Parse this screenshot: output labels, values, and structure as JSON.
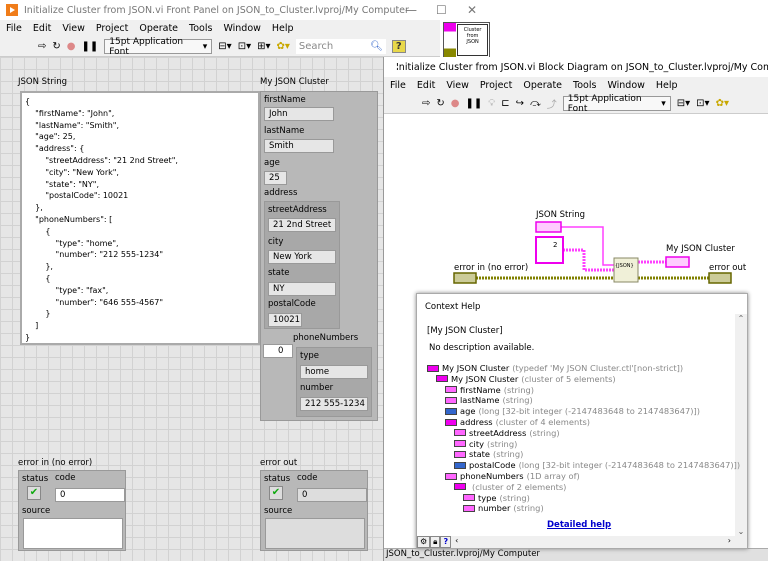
{
  "front_panel": {
    "title": "Initialize Cluster from JSON.vi Front Panel on JSON_to_Cluster.lvproj/My Computer",
    "menu": [
      "File",
      "Edit",
      "View",
      "Project",
      "Operate",
      "Tools",
      "Window",
      "Help"
    ],
    "font": "15pt Application Font",
    "search_placeholder": "Search",
    "icon_text": "Cluster from JSON",
    "json_string": {
      "label": "JSON String",
      "value": "{\n    \"firstName\": \"John\",\n    \"lastName\": \"Smith\",\n    \"age\": 25,\n    \"address\": {\n        \"streetAddress\": \"21 2nd Street\",\n        \"city\": \"New York\",\n        \"state\": \"NY\",\n        \"postalCode\": 10021\n    },\n    \"phoneNumbers\": [\n        {\n            \"type\": \"home\",\n            \"number\": \"212 555-1234\"\n        },\n        {\n            \"type\": \"fax\",\n            \"number\": \"646 555-4567\"\n        }\n    ]\n}"
    },
    "cluster": {
      "label": "My JSON Cluster",
      "firstName": {
        "label": "firstName",
        "value": "John"
      },
      "lastName": {
        "label": "lastName",
        "value": "Smith"
      },
      "age": {
        "label": "age",
        "value": "25"
      },
      "address": {
        "label": "address",
        "streetAddress": {
          "label": "streetAddress",
          "value": "21 2nd Street"
        },
        "city": {
          "label": "city",
          "value": "New York"
        },
        "state": {
          "label": "state",
          "value": "NY"
        },
        "postalCode": {
          "label": "postalCode",
          "value": "10021"
        }
      },
      "phoneNumbers": {
        "label": "phoneNumbers",
        "index": "0",
        "type": {
          "label": "type",
          "value": "home"
        },
        "number": {
          "label": "number",
          "value": "212 555-1234"
        }
      }
    },
    "error_in": {
      "label": "error in (no error)",
      "status": "status",
      "code_label": "code",
      "code": "0",
      "source": "source"
    },
    "error_out": {
      "label": "error out",
      "status": "status",
      "code_label": "code",
      "code": "0",
      "source": "source"
    }
  },
  "block_diagram": {
    "title": "Initialize Cluster from JSON.vi Block Diagram on JSON_to_Cluster.lvproj/My Computer",
    "menu": [
      "File",
      "Edit",
      "View",
      "Project",
      "Operate",
      "Tools",
      "Window",
      "Help"
    ],
    "font": "15pt Application Font",
    "json_string": "JSON String",
    "my_json_cluster": "My JSON Cluster",
    "error_in": "error in (no error)",
    "error_out": "error out",
    "node_text": "{JSON}",
    "const_text": "2",
    "status_bar": "JSON_to_Cluster.lvproj/My Computer",
    "wire_colors": {
      "string": "#ff40ff",
      "error": "#808000"
    }
  },
  "context_help": {
    "title": "Context Help",
    "heading": "[My JSON Cluster]",
    "description": "No description available.",
    "tree": [
      {
        "name": "My JSON Cluster",
        "type": "(typedef 'My JSON Cluster.ctl'[non-strict])",
        "depth": 0,
        "kind": "cluster"
      },
      {
        "name": "My JSON Cluster",
        "type": "(cluster of 5 elements)",
        "depth": 1,
        "kind": "cluster"
      },
      {
        "name": "firstName",
        "type": "(string)",
        "depth": 2,
        "kind": "string"
      },
      {
        "name": "lastName",
        "type": "(string)",
        "depth": 2,
        "kind": "string"
      },
      {
        "name": "age",
        "type": "(long [32-bit integer (-2147483648 to 2147483647)])",
        "depth": 2,
        "kind": "int"
      },
      {
        "name": "address",
        "type": "(cluster of 4 elements)",
        "depth": 2,
        "kind": "cluster"
      },
      {
        "name": "streetAddress",
        "type": "(string)",
        "depth": 3,
        "kind": "string"
      },
      {
        "name": "city",
        "type": "(string)",
        "depth": 3,
        "kind": "string"
      },
      {
        "name": "state",
        "type": "(string)",
        "depth": 3,
        "kind": "string"
      },
      {
        "name": "postalCode",
        "type": "(long [32-bit integer (-2147483648 to 2147483647)])",
        "depth": 3,
        "kind": "int"
      },
      {
        "name": "phoneNumbers",
        "type": "(1D array of)",
        "depth": 2,
        "kind": "array"
      },
      {
        "name": "",
        "type": "(cluster of 2 elements)",
        "depth": 3,
        "kind": "cluster"
      },
      {
        "name": "type",
        "type": "(string)",
        "depth": 4,
        "kind": "string"
      },
      {
        "name": "number",
        "type": "(string)",
        "depth": 4,
        "kind": "string"
      }
    ],
    "detailed_help": "Detailed help"
  }
}
